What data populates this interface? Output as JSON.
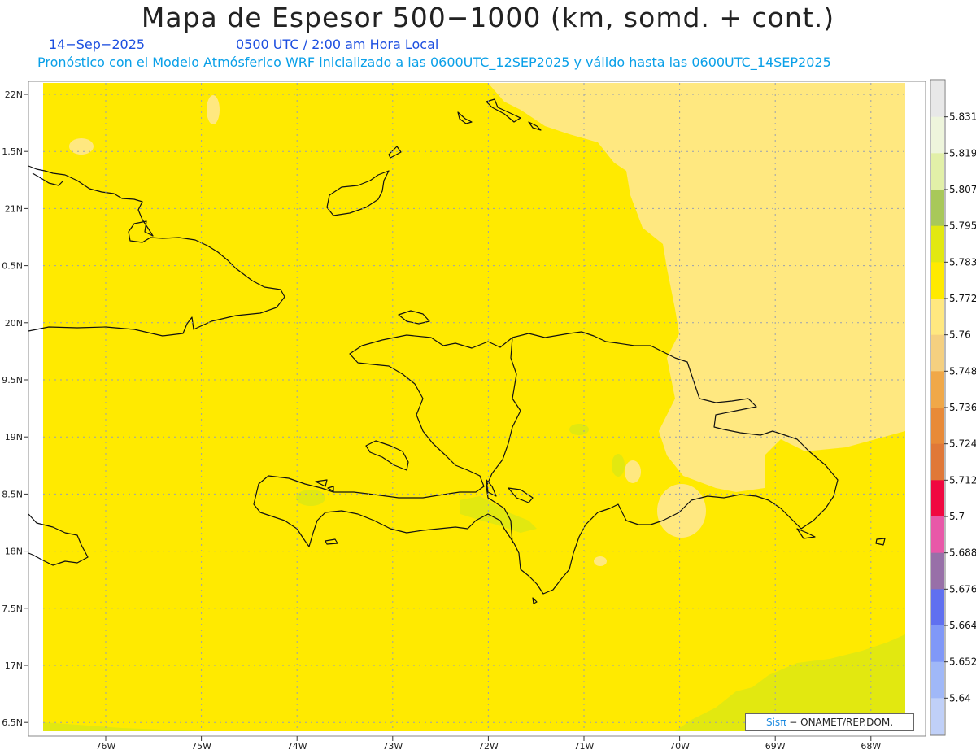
{
  "header": {
    "title": "Mapa de Espesor 500−1000 (km, somd. + cont.)",
    "date": "14−Sep−2025",
    "time": "0500 UTC / 2:00 am Hora Local",
    "description": "Pronóstico con el Modelo Atmósferico WRF inicializado a las 0600UTC_12SEP2025 y válido hasta las  0600UTC_14SEP2025"
  },
  "axes": {
    "lat_labels": [
      "22N",
      "1.5N",
      "21N",
      "0.5N",
      "20N",
      "9.5N",
      "19N",
      "8.5N",
      "18N",
      "7.5N",
      "17N",
      "6.5N"
    ],
    "lon_labels": [
      "76W",
      "75W",
      "74W",
      "73W",
      "72W",
      "71W",
      "70W",
      "69W",
      "68W"
    ]
  },
  "colorbar": {
    "labels": [
      "5.831",
      "5.819",
      "5.807",
      "5.795",
      "5.783",
      "5.772",
      "5.76",
      "5.748",
      "5.736",
      "5.724",
      "5.712",
      "5.7",
      "5.688",
      "5.676",
      "5.664",
      "5.652",
      "5.64"
    ],
    "colors": [
      "#e8e8e8",
      "#eef5dc",
      "#e2f0a8",
      "#a8c85a",
      "#e2e810",
      "#ffea00",
      "#ffe880",
      "#f5d080",
      "#f0a848",
      "#e88a38",
      "#e07838",
      "#f00840",
      "#e858a8",
      "#9870a8",
      "#6070f0",
      "#8098f8",
      "#a0b8f8",
      "#c0d0f8"
    ]
  },
  "map_colors": {
    "base": "#ffea00",
    "light": "#ffe880",
    "green": "#e2e810",
    "coast": "#111111",
    "grid": "#9aa0b0"
  },
  "credit": {
    "logo": "Sisπ",
    "text": "− ONAMET/REP.DOM."
  }
}
